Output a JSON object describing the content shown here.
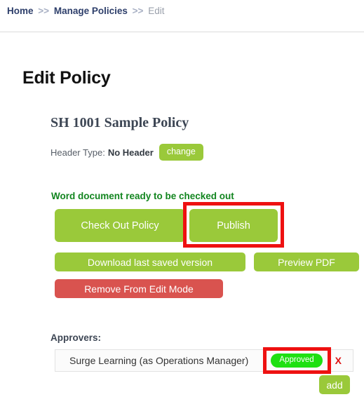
{
  "breadcrumb": {
    "items": [
      {
        "label": "Home",
        "current": false
      },
      {
        "label": "Manage Policies",
        "current": false
      },
      {
        "label": "Edit",
        "current": true
      }
    ],
    "separator": ">>"
  },
  "page": {
    "title": "Edit Policy"
  },
  "policy": {
    "name": "SH 1001 Sample Policy",
    "header_type_label": "Header Type:",
    "header_type_value": "No Header",
    "change_button": "change",
    "status_message": "Word document ready to be checked out"
  },
  "actions": {
    "check_out": "Check Out Policy",
    "publish": "Publish",
    "download": "Download last saved version",
    "preview_pdf": "Preview PDF",
    "remove_edit_mode": "Remove From Edit Mode"
  },
  "approvers": {
    "label": "Approvers:",
    "rows": [
      {
        "name": "Surge Learning (as Operations Manager)",
        "status": "Approved",
        "remove": "X"
      }
    ],
    "add_button": "add"
  },
  "colors": {
    "green_button": "#9ac93a",
    "red_button": "#d9534f",
    "badge_green": "#1ee012",
    "status_green": "#12851f",
    "annotation_red": "#ee1111",
    "breadcrumb_link": "#2e3f6b"
  }
}
